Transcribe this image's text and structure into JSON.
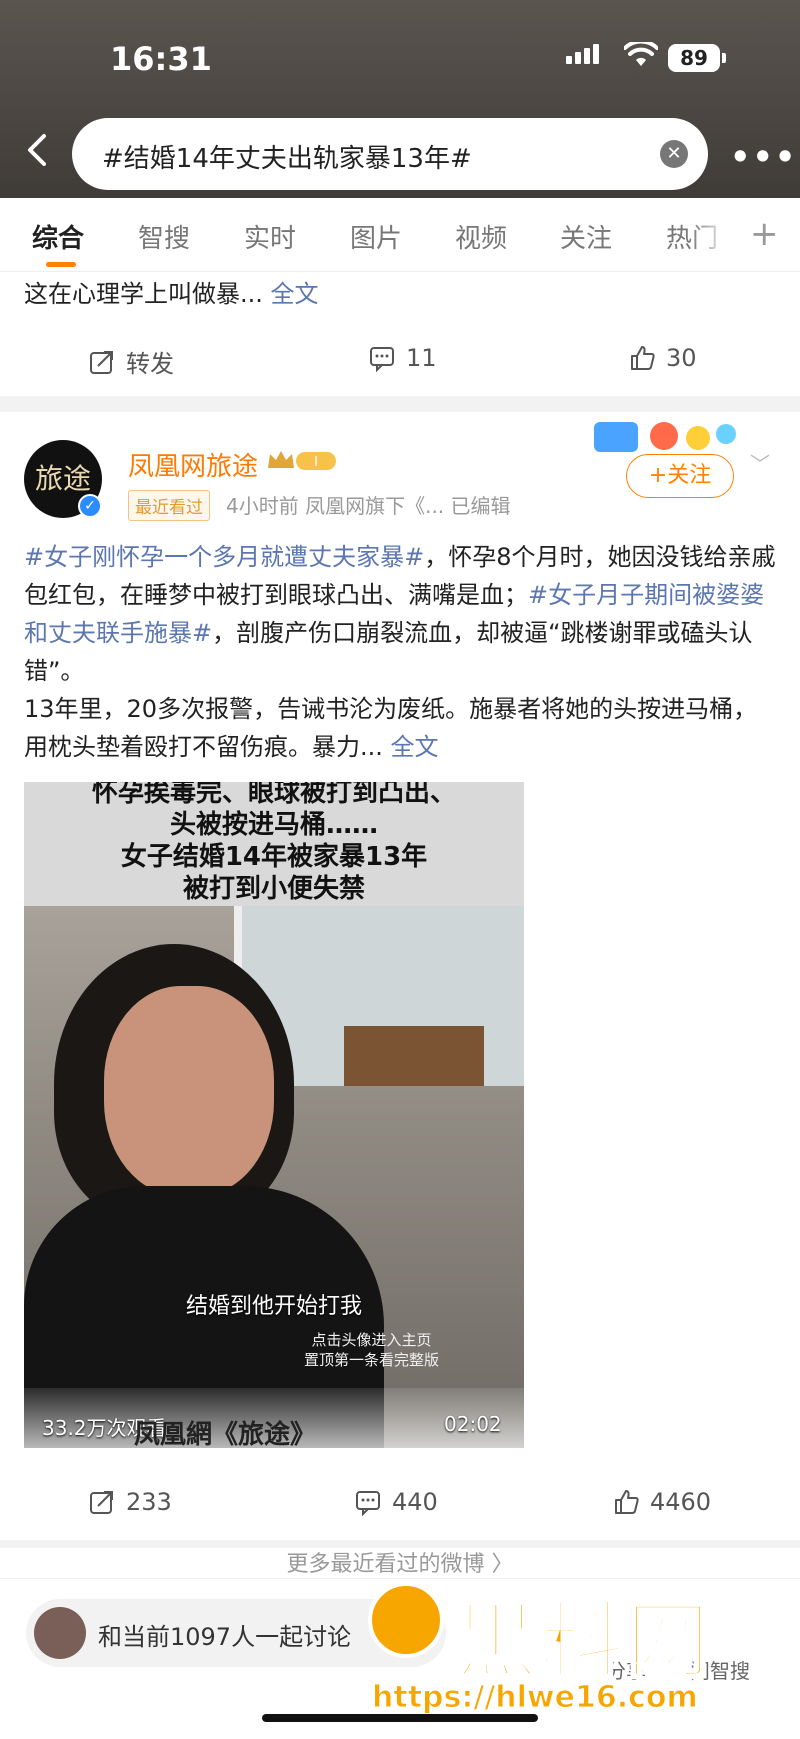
{
  "status_bar": {
    "time": "16:31",
    "battery": "89"
  },
  "search": {
    "query": "#结婚14年丈夫出轨家暴13年#"
  },
  "tabs": [
    "综合",
    "智搜",
    "实时",
    "图片",
    "视频",
    "关注",
    "热门"
  ],
  "tab_plus": "+",
  "previous_post": {
    "text": "这在心理学上叫做暴...",
    "full_text_link": "全文",
    "repost_label": "转发",
    "comment_count": "11",
    "like_count": "30"
  },
  "post": {
    "author": "凤凰网旅途",
    "avatar_text": "旅途",
    "recent_tag": "最近看过",
    "meta": "4小时前  凤凰网旗下《...  已编辑",
    "follow_label": "+关注",
    "body": {
      "tag1": "#女子刚怀孕一个多月就遭丈夫家暴#",
      "text1": "，怀孕8个月时，她因没钱给亲戚包红包，在睡梦中被打到眼球凸出、满嘴是血；",
      "tag2": "#女子月子期间被婆婆和丈夫联手施暴#",
      "text2": "，剖腹产伤口崩裂流血，却被逼“跳楼谢罪或磕头认错”。",
      "text3": "13年里，20多次报警，告诫书沦为废纸。施暴者将她的头按进马桶，用枕头垫着殴打不留伤痕。暴力...",
      "full_text_link": "全文"
    },
    "video": {
      "caption_lines": [
        "怀孕挨毒完、眼球被打到凸出、",
        "头被按进马桶……",
        "女子结婚14年被家暴13年",
        "被打到小便失禁"
      ],
      "subtitle": "结婚到他开始打我",
      "hint_lines": [
        "点击头像进入主页",
        "置顶第一条看完整版"
      ],
      "views": "33.2万次观看",
      "duration": "02:02",
      "brand": "凤凰網《旅途》"
    },
    "repost_count": "233",
    "comment_count": "440",
    "like_count": "4460"
  },
  "more_recent": "更多最近看过的微博  〉",
  "bottom_bar": {
    "discuss_text": "和当前1097人一起讨论",
    "share_label": "分享",
    "ask_label": "问智搜"
  },
  "watermark": {
    "text": "黑料网",
    "url": "https://hlwe16.com"
  },
  "colors": {
    "accent": "#ff8200",
    "link": "#5b76b0",
    "watermark": "#f7a600"
  }
}
